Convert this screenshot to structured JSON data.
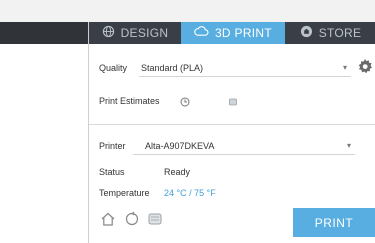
{
  "tabs": [
    {
      "label": "DESIGN",
      "icon": "globe-icon",
      "active": false
    },
    {
      "label": "3D PRINT",
      "icon": "cloud-print-icon",
      "active": true
    },
    {
      "label": "STORE",
      "icon": "store-icon",
      "active": false
    }
  ],
  "quality": {
    "label": "Quality",
    "value": "Standard (PLA)"
  },
  "print_estimates": {
    "label": "Print Estimates"
  },
  "printer": {
    "label": "Printer",
    "value": "Alta-A907DKEVA"
  },
  "status": {
    "label": "Status",
    "value": "Ready"
  },
  "temperature": {
    "label": "Temperature",
    "value": "24 °C / 75 °F"
  },
  "actions": {
    "print_label": "PRINT"
  },
  "colors": {
    "accent": "#58aee0",
    "tabbar": "#3a3f47",
    "temperature_text": "#3fa0d8"
  }
}
